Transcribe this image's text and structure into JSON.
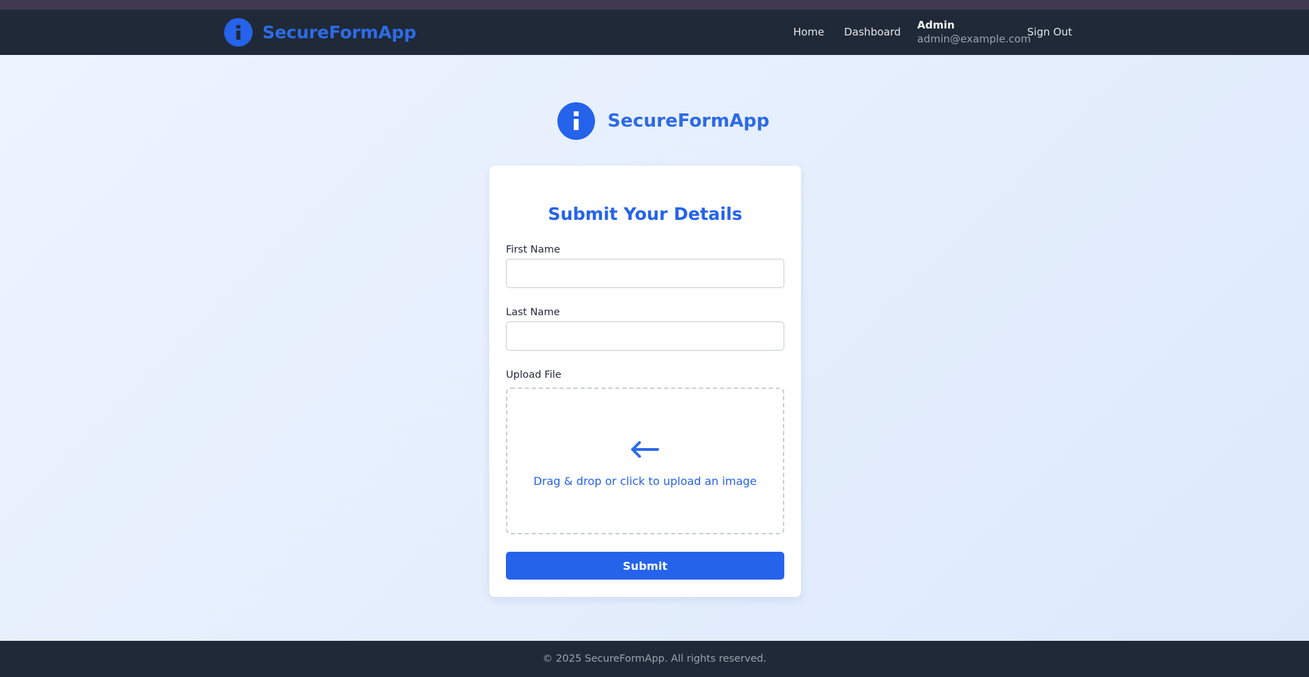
{
  "app": {
    "name": "SecureFormApp"
  },
  "colors": {
    "accent": "#2563eb",
    "navbar": "#1f2937",
    "footer": "#1f2937",
    "top_strip": "#3f3a4f"
  },
  "nav": {
    "links": [
      {
        "label": "Home"
      },
      {
        "label": "Dashboard"
      }
    ],
    "user": {
      "name": "Admin",
      "email": "admin@example.com"
    },
    "sign_out_label": "Sign Out",
    "logo_icon": "info-icon"
  },
  "hero": {
    "name": "SecureFormApp",
    "logo_icon": "info-icon"
  },
  "form": {
    "title": "Submit Your Details",
    "first_name": {
      "label": "First Name",
      "value": "",
      "placeholder": ""
    },
    "last_name": {
      "label": "Last Name",
      "value": "",
      "placeholder": ""
    },
    "upload": {
      "label": "Upload File",
      "prompt": "Drag & drop or click to upload an image",
      "icon": "arrow-left-icon"
    },
    "submit_label": "Submit"
  },
  "footer": {
    "text": "© 2025 SecureFormApp. All rights reserved."
  }
}
